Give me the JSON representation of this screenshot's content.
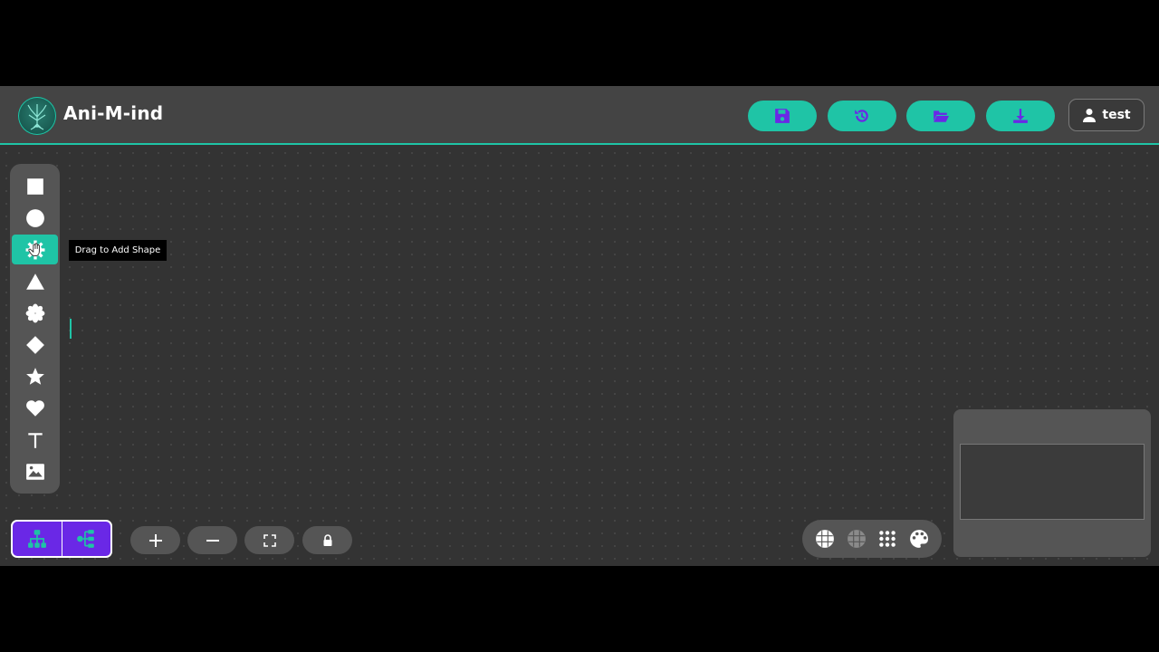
{
  "app": {
    "title": "Ani-M-ind"
  },
  "header": {
    "buttons": [
      {
        "name": "save",
        "icon": "floppy-disk-icon"
      },
      {
        "name": "history",
        "icon": "history-icon"
      },
      {
        "name": "open",
        "icon": "folder-open-icon"
      },
      {
        "name": "download",
        "icon": "download-icon"
      }
    ],
    "user": {
      "label": "test",
      "icon": "user-icon"
    }
  },
  "toolbar": {
    "tools": [
      {
        "name": "rectangle",
        "icon": "square-icon"
      },
      {
        "name": "circle",
        "icon": "circle-icon"
      },
      {
        "name": "gear",
        "icon": "gear-icon",
        "active": true
      },
      {
        "name": "triangle",
        "icon": "triangle-icon"
      },
      {
        "name": "burst",
        "icon": "asterisk-icon"
      },
      {
        "name": "diamond",
        "icon": "diamond-icon"
      },
      {
        "name": "star",
        "icon": "star-icon"
      },
      {
        "name": "heart",
        "icon": "heart-icon"
      },
      {
        "name": "text",
        "icon": "text-icon"
      },
      {
        "name": "image",
        "icon": "image-icon"
      }
    ],
    "tooltip": "Drag to Add Shape"
  },
  "bottom": {
    "layouts": [
      {
        "name": "tree-layout",
        "icon": "sitemap-icon"
      },
      {
        "name": "horizontal-layout",
        "icon": "mindmap-icon"
      }
    ],
    "zoom": [
      {
        "name": "zoom-in",
        "icon": "plus-icon"
      },
      {
        "name": "zoom-out",
        "icon": "minus-icon"
      },
      {
        "name": "fit-view",
        "icon": "expand-icon"
      },
      {
        "name": "lock",
        "icon": "lock-icon"
      }
    ],
    "background": [
      {
        "name": "grid-lines",
        "icon": "grid-icon"
      },
      {
        "name": "grid-faint",
        "icon": "grid-faint-icon"
      },
      {
        "name": "dots",
        "icon": "dots-icon"
      },
      {
        "name": "palette",
        "icon": "palette-icon"
      }
    ]
  },
  "colors": {
    "accent": "#1fc4a6",
    "purple": "#6a28e6",
    "header": "#444444",
    "canvas": "#333333",
    "panel": "#555555"
  }
}
